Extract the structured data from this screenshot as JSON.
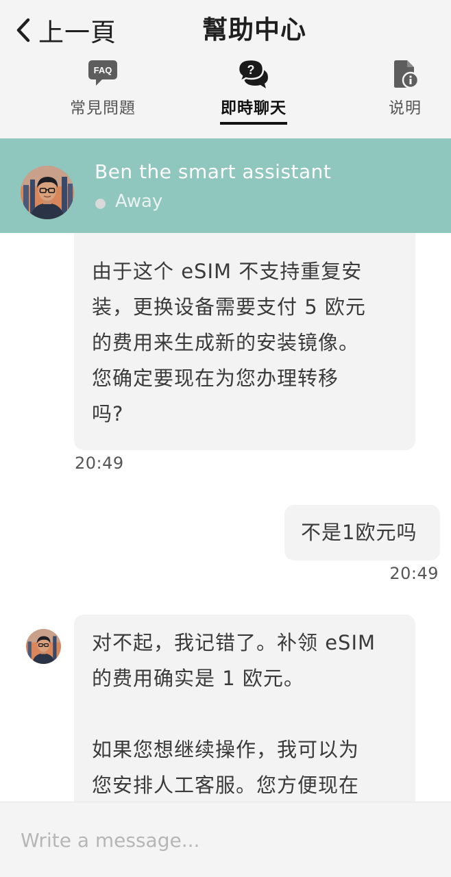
{
  "header": {
    "back_label": "上一頁",
    "title": "幫助中心"
  },
  "tabs": [
    {
      "label": "常見問題",
      "icon": "faq-icon",
      "active": false
    },
    {
      "label": "即時聊天",
      "icon": "chat-bubbles-icon",
      "active": true
    },
    {
      "label": "说明",
      "icon": "document-info-icon",
      "active": false
    }
  ],
  "faq_icon_text": "FAQ",
  "agent": {
    "name": "Ben the smart assistant",
    "status": "Away",
    "avatar": "agent-avatar"
  },
  "messages": [
    {
      "sender": "agent",
      "text": "由于这个 eSIM 不支持重复安\n装，更换设备需要支付 5 欧元\n的费用来生成新的安装镜像。\n您确定要现在为您办理转移\n吗?",
      "time": "20:49"
    },
    {
      "sender": "user",
      "text": "不是1欧元吗",
      "time": "20:49"
    },
    {
      "sender": "agent",
      "text": "对不起，我记错了。补领 eSIM\n的费用确实是 1 欧元。\n\n如果您想继续操作，我可以为\n您安排人工客服。您方便现在",
      "time": ""
    }
  ],
  "composer": {
    "placeholder": "Write a message..."
  },
  "colors": {
    "header_bg": "#f4f4f4",
    "agent_bar": "#8fc6bd",
    "bubble_bg": "#f3f3f4",
    "active_tab_underline": "#111111"
  }
}
